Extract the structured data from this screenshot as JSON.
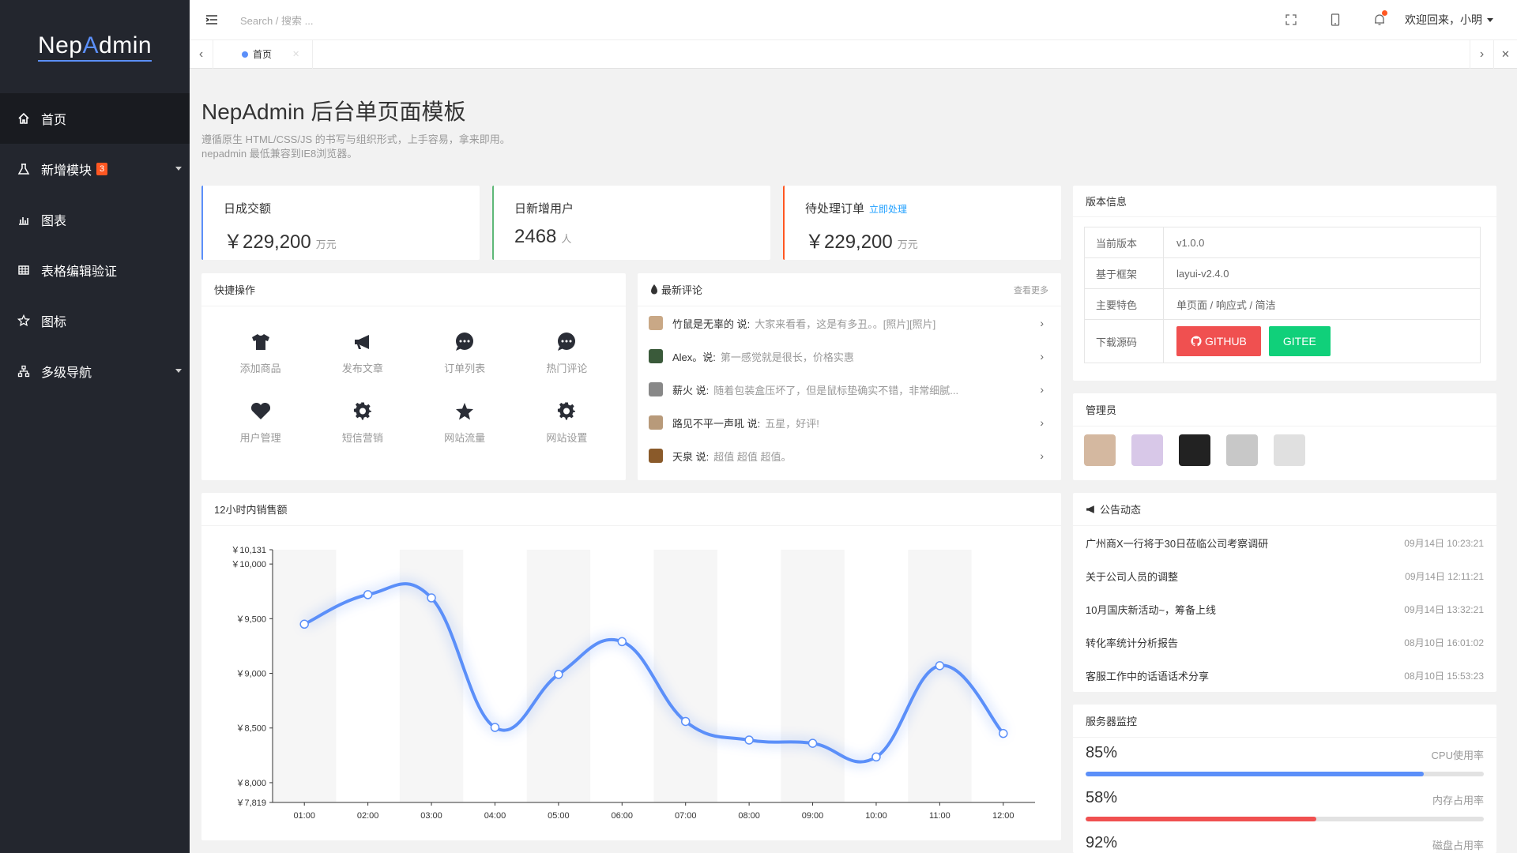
{
  "logo": {
    "part1": "Nep",
    "part2": "A",
    "part3": "dmin"
  },
  "sidebar": {
    "items": [
      {
        "label": "首页",
        "icon": "home-icon"
      },
      {
        "label": "新增模块",
        "icon": "flask-icon",
        "badge": "3"
      },
      {
        "label": "图表",
        "icon": "chart-icon"
      },
      {
        "label": "表格编辑验证",
        "icon": "table-icon"
      },
      {
        "label": "图标",
        "icon": "star-icon"
      },
      {
        "label": "多级导航",
        "icon": "sitemap-icon"
      }
    ]
  },
  "topbar": {
    "search_placeholder": "Search / 搜索 ...",
    "welcome": "欢迎回来，小明"
  },
  "tabs": {
    "items": [
      {
        "label": "首页"
      }
    ]
  },
  "page": {
    "title": "NepAdmin 后台单页面模板",
    "desc1": "遵循原生 HTML/CSS/JS 的书写与组织形式，上手容易，拿来即用。",
    "desc2": "nepadmin 最低兼容到IE8浏览器。"
  },
  "stats": [
    {
      "label": "日成交额",
      "value": "￥229,200",
      "unit": "万元",
      "color": "#1e9fff"
    },
    {
      "label": "日新增用户",
      "value": "2468",
      "unit": "人",
      "color": "#5fb878"
    },
    {
      "label": "待处理订单",
      "link": "立即处理",
      "value": "￥229,200",
      "unit": "万元",
      "color": "#ff5722"
    }
  ],
  "quick": {
    "title": "快捷操作",
    "items": [
      {
        "label": "添加商品",
        "icon": "shirt-icon"
      },
      {
        "label": "发布文章",
        "icon": "megaphone-icon"
      },
      {
        "label": "订单列表",
        "icon": "chat-icon"
      },
      {
        "label": "热门评论",
        "icon": "chat-icon"
      },
      {
        "label": "用户管理",
        "icon": "heart-icon"
      },
      {
        "label": "短信营销",
        "icon": "gear-icon"
      },
      {
        "label": "网站流量",
        "icon": "star-icon"
      },
      {
        "label": "网站设置",
        "icon": "gear-icon"
      }
    ]
  },
  "comments": {
    "title": "最新评论",
    "more": "查看更多",
    "items": [
      {
        "name": "竹鼠是无辜的 说:",
        "text": "大家来看看，这是有多丑。。[照片][照片]",
        "color": "#c9a886"
      },
      {
        "name": "Alex。说:",
        "text": "第一感觉就是很长，价格实惠",
        "color": "#3a5a3a"
      },
      {
        "name": "薪火 说:",
        "text": "随着包装盒压坏了，但是鼠标垫确实不错，非常细腻...",
        "color": "#888"
      },
      {
        "name": "路见不平一声吼 说:",
        "text": "五星，好评!",
        "color": "#b89a7a"
      },
      {
        "name": "天泉 说:",
        "text": "超值 超值 超值。",
        "color": "#8a5a2a"
      }
    ]
  },
  "version": {
    "title": "版本信息",
    "rows": [
      {
        "k": "当前版本",
        "v": "v1.0.0"
      },
      {
        "k": "基于框架",
        "v": "layui-v2.4.0"
      },
      {
        "k": "主要特色",
        "v": "单页面 / 响应式 / 简洁"
      }
    ],
    "download_label": "下载源码",
    "github": "GITHUB",
    "gitee": "GITEE",
    "github_color": "#f05050",
    "gitee_color": "#10d07a"
  },
  "admins": {
    "title": "管理员",
    "colors": [
      "#d4b8a0",
      "#d8c8e8",
      "#222",
      "#c8c8c8",
      "#e0e0e0"
    ]
  },
  "notices": {
    "title": "公告动态",
    "items": [
      {
        "t": "广州商X一行将于30日莅临公司考察调研",
        "d": "09月14日 10:23:21"
      },
      {
        "t": "关于公司人员的调整",
        "d": "09月14日 12:11:21"
      },
      {
        "t": "10月国庆新活动~，筹备上线",
        "d": "09月14日 13:32:21"
      },
      {
        "t": "转化率统计分析报告",
        "d": "08月10日 16:01:02"
      },
      {
        "t": "客服工作中的话语话术分享",
        "d": "08月10日 15:53:23"
      }
    ]
  },
  "server": {
    "title": "服务器监控",
    "items": [
      {
        "pct": "85%",
        "label": "CPU使用率",
        "value": 85,
        "color": "#5b8ff9"
      },
      {
        "pct": "58%",
        "label": "内存占用率",
        "value": 58,
        "color": "#f05050"
      },
      {
        "pct": "92%",
        "label": "磁盘占用率",
        "value": 92,
        "color": "#5fb878"
      }
    ]
  },
  "chart_data": {
    "type": "line",
    "title": "12小时内销售额",
    "categories": [
      "01:00",
      "02:00",
      "03:00",
      "04:00",
      "05:00",
      "06:00",
      "07:00",
      "08:00",
      "09:00",
      "10:00",
      "11:00",
      "12:00"
    ],
    "values": [
      9450,
      9720,
      9690,
      8505,
      8990,
      9290,
      8560,
      8390,
      8360,
      8235,
      9070,
      8450
    ],
    "yticks": [
      "￥10,131",
      "￥10,000",
      "￥9,500",
      "￥9,000",
      "￥8,500",
      "￥8,000",
      "￥7,819"
    ],
    "ytick_values": [
      10131,
      10000,
      9500,
      9000,
      8500,
      8000,
      7819
    ],
    "ylim": [
      7819,
      10131
    ],
    "color": "#5b8ff9"
  }
}
